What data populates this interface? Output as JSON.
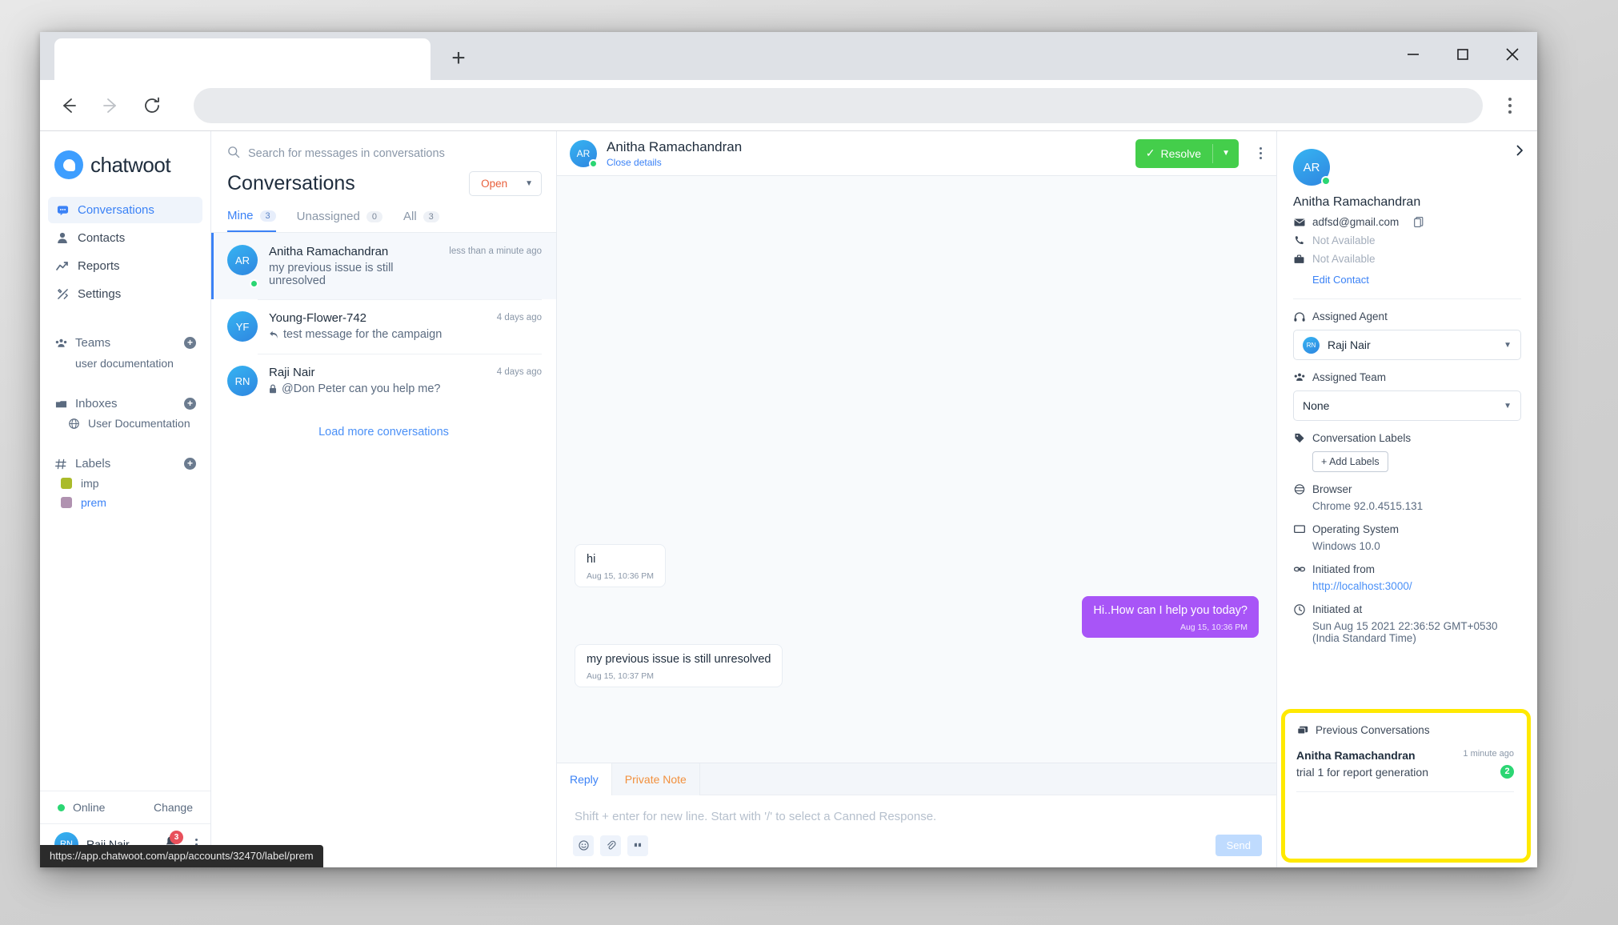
{
  "browser": {
    "tab_title": "",
    "new_tab_label": "+",
    "address_value": "",
    "address_placeholder": "",
    "status_url": "https://app.chatwoot.com/app/accounts/32470/label/prem"
  },
  "sidebar": {
    "brand": "chatwoot",
    "nav": [
      {
        "label": "Conversations",
        "icon": "chat-icon",
        "active": true
      },
      {
        "label": "Contacts",
        "icon": "person-icon",
        "active": false
      },
      {
        "label": "Reports",
        "icon": "chart-line-icon",
        "active": false
      },
      {
        "label": "Settings",
        "icon": "tools-icon",
        "active": false
      }
    ],
    "teams": {
      "title": "Teams",
      "items": [
        "user documentation"
      ]
    },
    "inboxes": {
      "title": "Inboxes",
      "items": [
        "User Documentation"
      ]
    },
    "labels": {
      "title": "Labels",
      "items": [
        {
          "name": "imp",
          "color": "#aabb2a",
          "active": false
        },
        {
          "name": "prem",
          "color": "#b092b0",
          "active": true
        }
      ]
    },
    "status": {
      "state": "Online",
      "change": "Change"
    },
    "agent": {
      "name": "Raji Nair",
      "initials": "RN",
      "notifications": "3"
    }
  },
  "conversations": {
    "search_placeholder": "Search for messages in conversations",
    "title": "Conversations",
    "filter": "Open",
    "tabs": [
      {
        "label": "Mine",
        "count": "3",
        "selected": true
      },
      {
        "label": "Unassigned",
        "count": "0",
        "selected": false
      },
      {
        "label": "All",
        "count": "3",
        "selected": false
      }
    ],
    "items": [
      {
        "initials": "AR",
        "name": "Anitha Ramachandran",
        "preview": "my previous issue is still unresolved",
        "time": "less than a minute ago",
        "selected": true,
        "online": true,
        "preview_icon": ""
      },
      {
        "initials": "YF",
        "name": "Young-Flower-742",
        "preview": "test message for the campaign",
        "time": "4 days ago",
        "selected": false,
        "online": false,
        "preview_icon": "reply-icon"
      },
      {
        "initials": "RN",
        "name": "Raji Nair",
        "preview": "@Don Peter can you help me?",
        "time": "4 days ago",
        "selected": false,
        "online": false,
        "preview_icon": "lock-icon"
      }
    ],
    "load_more": "Load more conversations"
  },
  "conversation": {
    "header": {
      "initials": "AR",
      "name": "Anitha Ramachandran",
      "subtitle": "Close details",
      "resolve_label": "Resolve"
    },
    "messages": [
      {
        "text": "hi",
        "time": "Aug 15, 10:36 PM",
        "direction": "in"
      },
      {
        "text": "Hi..How can I help you today?",
        "time": "Aug 15, 10:36 PM",
        "direction": "out"
      },
      {
        "text": "my previous issue is still unresolved",
        "time": "Aug 15, 10:37 PM",
        "direction": "in"
      }
    ],
    "composer": {
      "tab_reply": "Reply",
      "tab_note": "Private Note",
      "placeholder": "Shift + enter for new line. Start with '/' to select a Canned Response.",
      "send_label": "Send"
    }
  },
  "contact_panel": {
    "initials": "AR",
    "name": "Anitha Ramachandran",
    "email": "adfsd@gmail.com",
    "phone": "Not Available",
    "company": "Not Available",
    "edit_contact": "Edit Contact",
    "assigned_agent_label": "Assigned Agent",
    "assigned_agent_value": "Raji Nair",
    "assigned_agent_initials": "RN",
    "assigned_team_label": "Assigned Team",
    "assigned_team_value": "None",
    "conversation_labels_label": "Conversation Labels",
    "add_labels": "+ Add Labels",
    "browser_label": "Browser",
    "browser_value": "Chrome 92.0.4515.131",
    "os_label": "Operating System",
    "os_value": "Windows 10.0",
    "initiated_from_label": "Initiated from",
    "initiated_from_value": "http://localhost:3000/",
    "initiated_at_label": "Initiated at",
    "initiated_at_value": "Sun Aug 15 2021 22:36:52 GMT+0530 (India Standard Time)",
    "previous_conversations_label": "Previous Conversations",
    "previous": [
      {
        "name": "Anitha Ramachandran",
        "snippet": "trial 1 for report generation",
        "time": "1 minute ago",
        "badge": "2"
      }
    ],
    "highlight_color": "#ffe900"
  }
}
